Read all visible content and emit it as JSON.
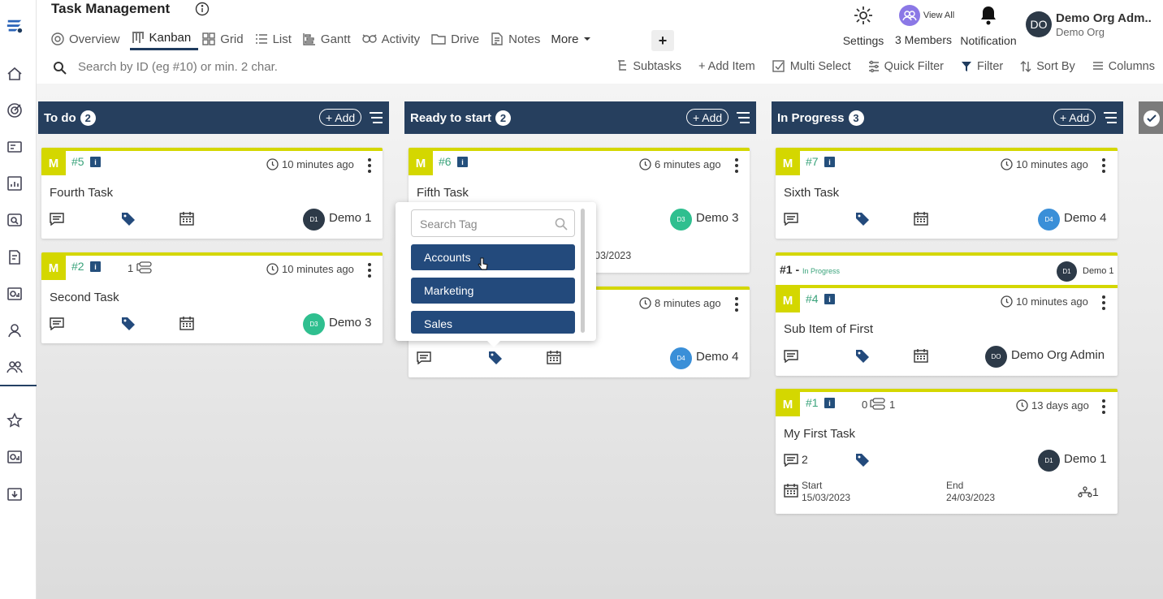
{
  "app": {
    "title": "Task Management"
  },
  "nav": {
    "tabs": [
      {
        "label": "Overview",
        "icon": "overview-icon"
      },
      {
        "label": "Kanban",
        "icon": "kanban-icon",
        "active": true
      },
      {
        "label": "Grid",
        "icon": "grid-icon"
      },
      {
        "label": "List",
        "icon": "list-icon"
      },
      {
        "label": "Gantt",
        "icon": "gantt-icon"
      },
      {
        "label": "Activity",
        "icon": "activity-icon"
      },
      {
        "label": "Drive",
        "icon": "folder-icon"
      },
      {
        "label": "Notes",
        "icon": "notes-icon"
      },
      {
        "label": "More",
        "icon": "caret-down-icon"
      }
    ]
  },
  "header": {
    "settings": "Settings",
    "view_all": "View All",
    "members": "3 Members",
    "notification": "Notification",
    "user_initials": "DO",
    "user_name": "Demo Org Adm..",
    "org": "Demo Org"
  },
  "search": {
    "placeholder": "Search by ID (eg #10) or min. 2 char."
  },
  "toolbar": {
    "subtasks": "Subtasks",
    "add_item": "+ Add Item",
    "multi_select": "Multi Select",
    "quick_filter": "Quick Filter",
    "filter": "Filter",
    "sort_by": "Sort By",
    "columns": "Columns"
  },
  "columns": [
    {
      "title": "To do",
      "count": "2",
      "add": "+ Add"
    },
    {
      "title": "Ready to start",
      "count": "2",
      "add": "+ Add"
    },
    {
      "title": "In Progress",
      "count": "3",
      "add": "+ Add"
    }
  ],
  "cards": {
    "fourth": {
      "badge": "M",
      "id": "#5",
      "time": "10 minutes ago",
      "title": "Fourth Task",
      "avatar": "D1",
      "assignee": "Demo 1"
    },
    "second": {
      "badge": "M",
      "id": "#2",
      "sub_count": "1",
      "time": "10 minutes ago",
      "title": "Second Task",
      "avatar": "D3",
      "assignee": "Demo 3"
    },
    "fifth": {
      "badge": "M",
      "id": "#6",
      "time": "6 minutes ago",
      "title": "Fifth Task",
      "avatar": "D3",
      "assignee": "Demo 3",
      "date_fragment": "03/2023"
    },
    "hidden": {
      "time": "8 minutes ago",
      "avatar": "D4",
      "assignee": "Demo 4"
    },
    "sixth": {
      "badge": "M",
      "id": "#7",
      "time": "10 minutes ago",
      "title": "Sixth Task",
      "avatar": "D4",
      "assignee": "Demo 4"
    },
    "parent": {
      "id": "#1 -",
      "status": "In Progress",
      "avatar": "D1",
      "assignee": "Demo 1"
    },
    "subitem": {
      "badge": "M",
      "id": "#4",
      "time": "10 minutes ago",
      "title": "Sub Item of First",
      "avatar": "DO",
      "assignee": "Demo Org Admin"
    },
    "first": {
      "badge": "M",
      "id": "#1",
      "sub_done": "0",
      "sub_total": "1",
      "time": "13 days ago",
      "title": "My First Task",
      "comments": "2",
      "avatar": "D1",
      "assignee": "Demo 1",
      "start_label": "Start",
      "start": "15/03/2023",
      "end_label": "End",
      "end": "24/03/2023",
      "deps": "1"
    }
  },
  "tag_dropdown": {
    "placeholder": "Search Tag",
    "options": [
      "Accounts",
      "Marketing",
      "Sales"
    ]
  },
  "colors": {
    "navy": "#263f5e",
    "accent_yellow": "#d4d700",
    "tag_blue": "#234a7c",
    "id_green": "#3aa37b"
  }
}
